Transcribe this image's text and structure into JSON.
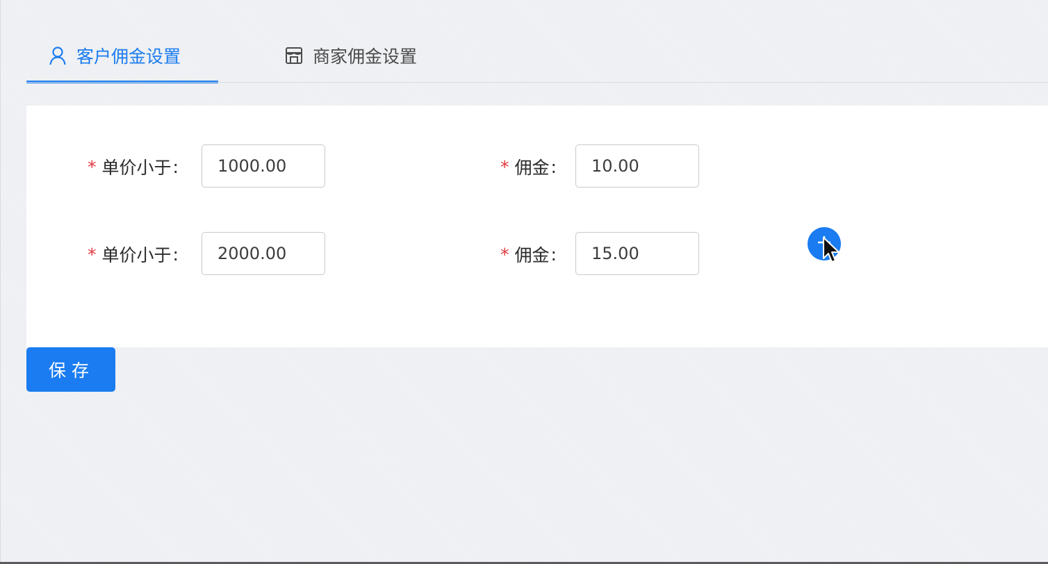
{
  "tabs": [
    {
      "label": "客户佣金设置",
      "icon": "user-icon",
      "active": true
    },
    {
      "label": "商家佣金设置",
      "icon": "store-icon",
      "active": false
    }
  ],
  "form": {
    "rows": [
      {
        "price_label": "单价小于",
        "price_value": "1000.00",
        "commission_label": "佣金",
        "commission_value": "10.00"
      },
      {
        "price_label": "单价小于",
        "price_value": "2000.00",
        "commission_label": "佣金",
        "commission_value": "15.00"
      }
    ],
    "required_mark": "*",
    "colon": ":"
  },
  "add_button": {
    "icon": "plus-icon"
  },
  "save_button": {
    "label": "保存"
  },
  "colors": {
    "primary": "#1a7cf0",
    "required": "#e0393e",
    "background": "#f0f2f5",
    "panel": "#ffffff"
  }
}
